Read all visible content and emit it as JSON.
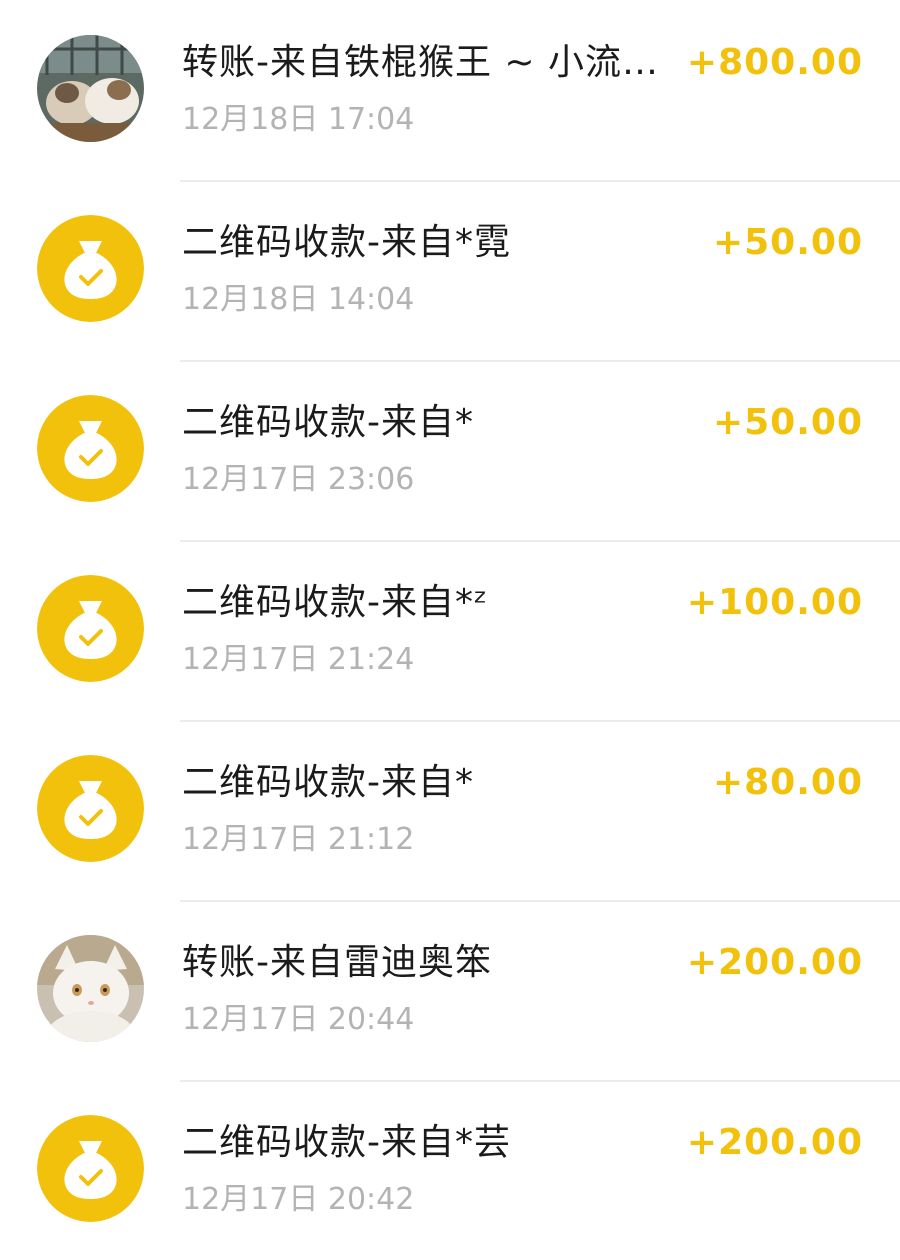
{
  "colors": {
    "amount": "#f2c10c",
    "icon_bg": "#f2c10c",
    "title": "#1b1b1b",
    "time": "#b3b3b3",
    "divider": "#ececec"
  },
  "transactions": [
    {
      "icon": "cat-photo-avatar",
      "title": "转账-来自铁棍猴王 ~ 小流…",
      "time": "12月18日 17:04",
      "amount": "+800.00"
    },
    {
      "icon": "money-bag-check-icon",
      "title": "二维码收款-来自*霓",
      "time": "12月18日 14:04",
      "amount": "+50.00"
    },
    {
      "icon": "money-bag-check-icon",
      "title": "二维码收款-来自*",
      "time": "12月17日 23:06",
      "amount": "+50.00"
    },
    {
      "icon": "money-bag-check-icon",
      "title": "二维码收款-来自*ᶻ",
      "time": "12月17日 21:24",
      "amount": "+100.00"
    },
    {
      "icon": "money-bag-check-icon",
      "title": "二维码收款-来自*",
      "time": "12月17日 21:12",
      "amount": "+80.00"
    },
    {
      "icon": "white-cat-photo-avatar",
      "title": "转账-来自雷迪奥笨",
      "time": "12月17日 20:44",
      "amount": "+200.00"
    },
    {
      "icon": "money-bag-check-icon",
      "title": "二维码收款-来自*芸",
      "time": "12月17日 20:42",
      "amount": "+200.00"
    }
  ]
}
